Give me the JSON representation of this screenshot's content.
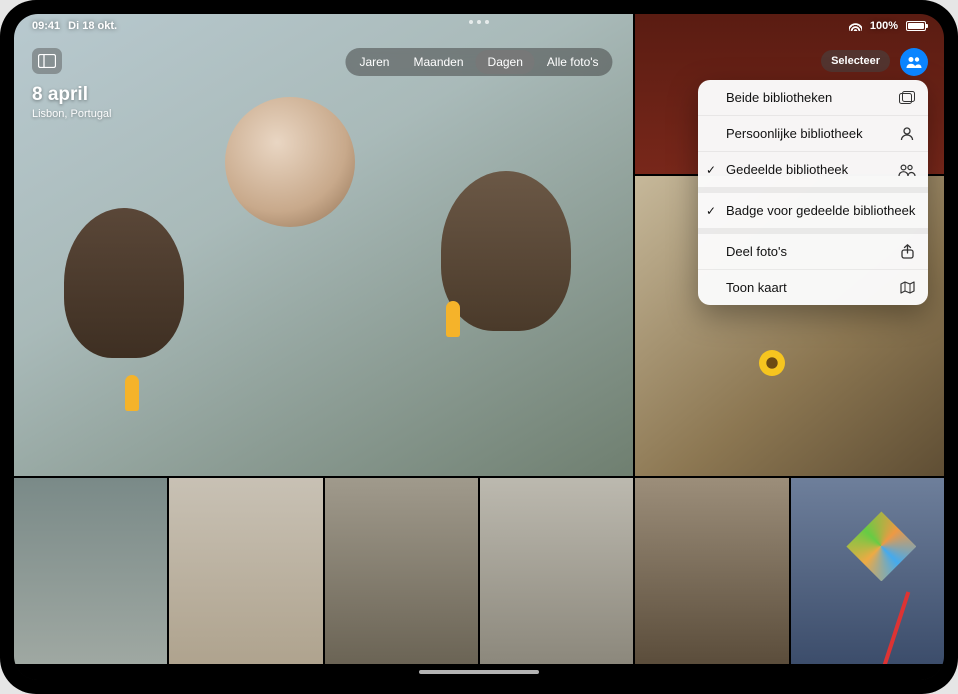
{
  "status": {
    "time": "09:41",
    "date": "Di 18 okt.",
    "battery_pct": "100%"
  },
  "header": {
    "date_title": "8 april",
    "location": "Lisbon, Portugal",
    "select_label": "Selecteer"
  },
  "segmented": {
    "items": [
      "Jaren",
      "Maanden",
      "Dagen",
      "Alle foto's"
    ],
    "active_index": 2
  },
  "menu": {
    "both_libraries": "Beide bibliotheken",
    "personal_library": "Persoonlijke bibliotheek",
    "shared_library": "Gedeelde bibliotheek",
    "shared_badge": "Badge voor gedeelde bibliotheek",
    "share_photos": "Deel foto's",
    "show_map": "Toon kaart",
    "checked": {
      "shared_library": true,
      "shared_badge": true
    }
  }
}
